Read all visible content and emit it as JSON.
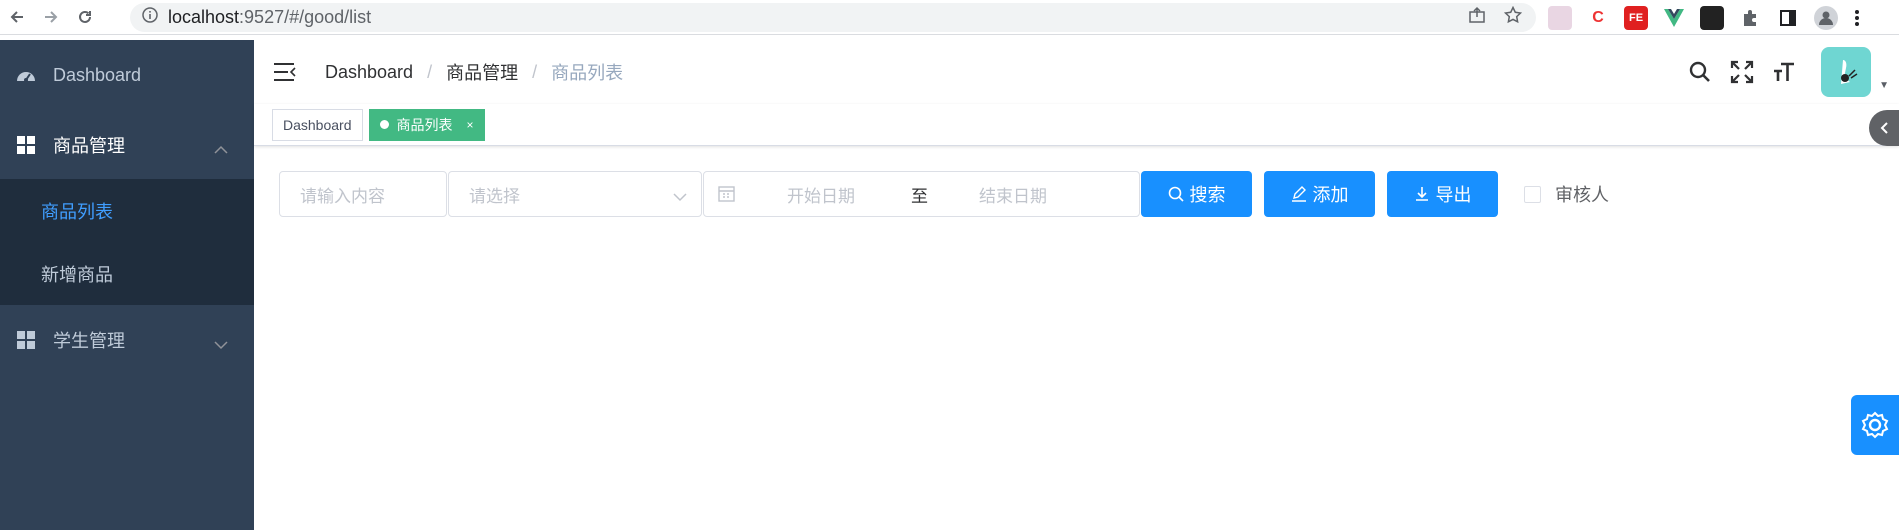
{
  "browser": {
    "url_host": "localhost",
    "url_rest": ":9527/#/good/list"
  },
  "sidebar": {
    "items": [
      {
        "label": "Dashboard",
        "icon": "dashboard-icon"
      },
      {
        "label": "商品管理",
        "icon": "grid-icon",
        "expanded": true,
        "children": [
          {
            "label": "商品列表",
            "active": true
          },
          {
            "label": "新增商品",
            "active": false
          }
        ]
      },
      {
        "label": "学生管理",
        "icon": "grid-icon",
        "expanded": false
      }
    ]
  },
  "navbar": {
    "breadcrumb": [
      "Dashboard",
      "商品管理",
      "商品列表"
    ]
  },
  "tags": [
    {
      "label": "Dashboard",
      "active": false
    },
    {
      "label": "商品列表",
      "active": true,
      "close": "×"
    }
  ],
  "filter": {
    "input_placeholder": "请输入内容",
    "select_placeholder": "请选择",
    "date_start_placeholder": "开始日期",
    "date_separator": "至",
    "date_end_placeholder": "结束日期",
    "search_label": "搜索",
    "add_label": "添加",
    "export_label": "导出",
    "checkbox_label": "审核人"
  },
  "colors": {
    "sidebar_bg": "#304156",
    "submenu_bg": "#1f2d3d",
    "accent": "#1890ff",
    "active_tag": "#42b983",
    "active_menu_text": "#409eff"
  }
}
